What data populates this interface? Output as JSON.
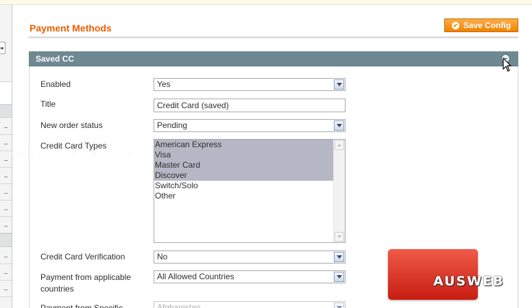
{
  "page": {
    "title": "Payment Methods",
    "save_button": "Save Config"
  },
  "section": {
    "title": "Saved CC",
    "collapsed": false
  },
  "fields": {
    "enabled": {
      "label": "Enabled",
      "value": "Yes"
    },
    "title": {
      "label": "Title",
      "value": "Credit Card (saved)"
    },
    "order_status": {
      "label": "New order status",
      "value": "Pending"
    },
    "cc_types": {
      "label": "Credit Card Types",
      "options": [
        {
          "label": "American Express",
          "selected": true
        },
        {
          "label": "Visa",
          "selected": true
        },
        {
          "label": "Master Card",
          "selected": true
        },
        {
          "label": "Discover",
          "selected": true
        },
        {
          "label": "Switch/Solo",
          "selected": false
        },
        {
          "label": "Other",
          "selected": false
        }
      ]
    },
    "cc_verification": {
      "label": "Credit Card Verification",
      "value": "No"
    },
    "applicable_countries": {
      "label": "Payment from applicable countries",
      "value": "All Allowed Countries"
    },
    "specific_countries": {
      "label": "Payment from Specific",
      "value": "Afghanistan"
    }
  },
  "watermark": {
    "url_text": "www.vebrip.com",
    "logo_text": "AUSWEB"
  },
  "colors": {
    "accent_orange": "#eb5e00",
    "button_orange": "#f18200",
    "section_header": "#6f8992",
    "selected_option": "#b5b7c5",
    "logo_red": "#d93a2b"
  },
  "icons": {
    "save_button_icon": "check-circle-icon",
    "section_toggle_icon": "collapse-circle-icon",
    "mouse_cursor": "arrow-cursor-icon"
  }
}
